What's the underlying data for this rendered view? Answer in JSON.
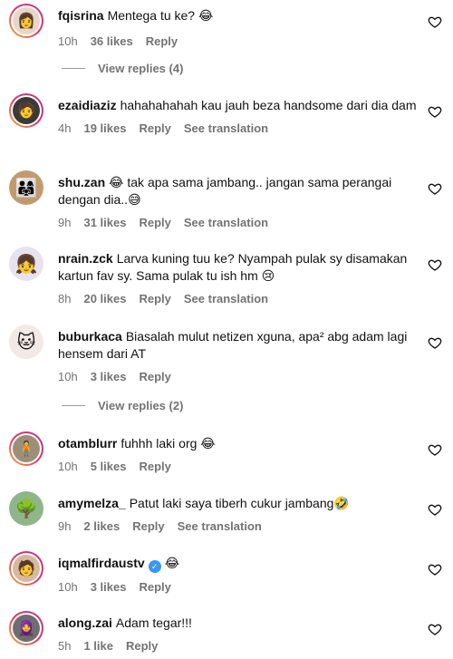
{
  "comments": [
    {
      "username": "fqisrina",
      "text": "Mentega tu ke? 😂",
      "time": "10h",
      "likes": "36 likes",
      "reply": "Reply",
      "avatar": "👩",
      "see_translation": ""
    },
    {
      "username": "ezaidiaziz",
      "text": "hahahahahah kau jauh beza handsome dari dia dam",
      "time": "4h",
      "likes": "19 likes",
      "reply": "Reply",
      "avatar": "🧑",
      "see_translation": "See translation"
    },
    {
      "username": "shu.zan",
      "text": "😂 tak apa sama jambang.. jangan sama perangai dengan dia..😅",
      "time": "9h",
      "likes": "31 likes",
      "reply": "Reply",
      "avatar": "👨‍👩‍👧",
      "see_translation": "See translation"
    },
    {
      "username": "nrain.zck",
      "text": "Larva kuning tuu ke? Nyampah pulak sy disamakan kartun fav sy. Sama pulak tu ish hm 😢",
      "time": "8h",
      "likes": "20 likes",
      "reply": "Reply",
      "avatar": "👧",
      "see_translation": "See translation"
    },
    {
      "username": "buburkaca",
      "text": "Biasalah mulut netizen xguna, apa² abg adam lagi hensem dari AT",
      "time": "10h",
      "likes": "3 likes",
      "reply": "Reply",
      "avatar": "🐱",
      "see_translation": ""
    },
    {
      "username": "otamblurr",
      "text": "fuhhh laki org 😂",
      "time": "10h",
      "likes": "5 likes",
      "reply": "Reply",
      "avatar": "🧍",
      "see_translation": ""
    },
    {
      "username": "amymelza_",
      "text": "Patut laki saya tiberh cukur jambang🤣",
      "time": "9h",
      "likes": "2 likes",
      "reply": "Reply",
      "avatar": "🌳",
      "see_translation": "See translation"
    },
    {
      "username": "iqmalfirdaustv",
      "text": "😂",
      "time": "10h",
      "likes": "3 likes",
      "reply": "Reply",
      "avatar": "🧑",
      "see_translation": "",
      "verified": true
    },
    {
      "username": "along.zai",
      "text": "Adam tegar!!!",
      "time": "5h",
      "likes": "1 like",
      "reply": "Reply",
      "avatar": "🧕",
      "see_translation": ""
    }
  ],
  "view_replies": [
    "View replies (4)",
    "View replies (2)"
  ],
  "colors": {
    "meta": "#737373",
    "ring_start": "#f9b233",
    "ring_end": "#c13584",
    "verified": "#3897f0"
  },
  "icons": {
    "like": "heart-outline-icon",
    "verified": "verified-badge-icon"
  }
}
